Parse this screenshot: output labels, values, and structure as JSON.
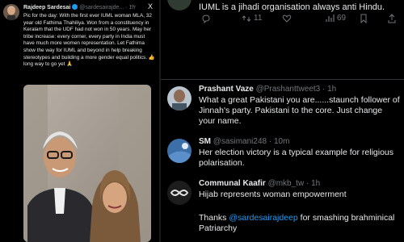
{
  "left_tweet": {
    "author": "Rajdeep Sardesai",
    "handle": "@sardesairajde...",
    "time": "1h",
    "text": "Pic for the day: With the first ever IUML woman MLA, 32 year old Fathima Thahiliya. Won from a constituency in Keralam that the UDF had not won in 50 years. May her tribe increase: every corner, every party in India must have much more women representation. Let Fathima show the way for IUML and beyond in help breaking stereotypes and building a more gender equal politics. 👍 long way to go yet 🙏",
    "close_glyph": "X",
    "more_glyph": "···"
  },
  "right": {
    "top_tweet_text": "IUML is a jihadi organisation always anti Hindu.",
    "actions": {
      "retweets": "11",
      "views": "69"
    },
    "replies": [
      {
        "author": "Prashant Vaze",
        "handle": "@Prashanttweet3",
        "time": "1h",
        "text": "What a great Pakistani you are......staunch follower of Jinnah's party. Pakistani to the core. Just change your name."
      },
      {
        "author": "SM",
        "handle": "@sasimani248",
        "time": "10m",
        "text": "Her election victory is a typical example for religious polarisation."
      },
      {
        "author": "Communal Kaafir",
        "handle": "@mkb_tw",
        "time": "1h",
        "text_line1": "Hijab represents woman empowerment",
        "text_prefix": "Thanks ",
        "mention": "@sardesairajdeep",
        "text_suffix": " for smashing brahminical Patriarchy"
      }
    ]
  },
  "colors": {
    "accent": "#1d9bf0",
    "muted": "#71767b",
    "text": "#e7e9ea",
    "bg": "#000000"
  }
}
